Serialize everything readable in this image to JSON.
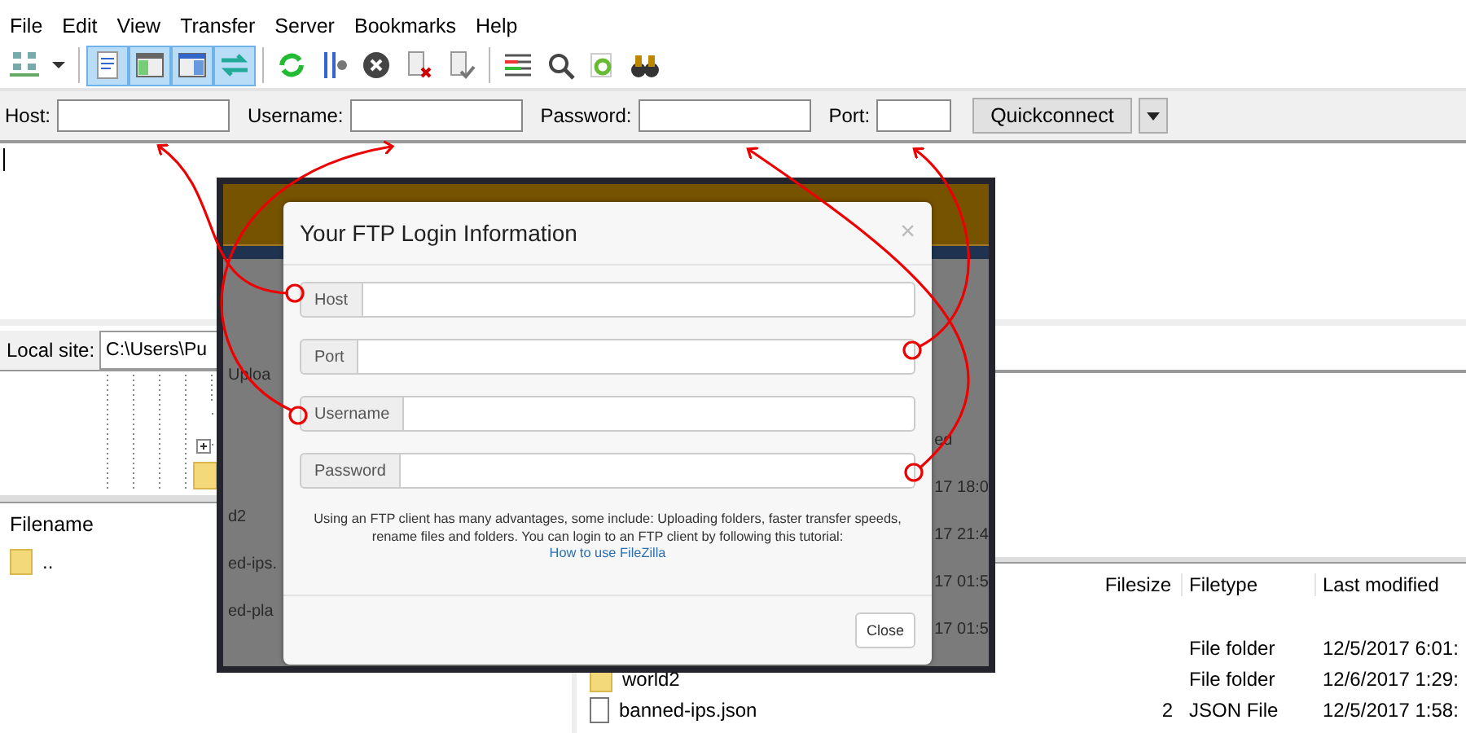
{
  "menu": [
    "File",
    "Edit",
    "View",
    "Transfer",
    "Server",
    "Bookmarks",
    "Help"
  ],
  "toolbar": [
    {
      "kind": "sitemanager",
      "pressed": false
    },
    {
      "kind": "dropdown",
      "pressed": false
    },
    {
      "kind": "sep"
    },
    {
      "kind": "log",
      "pressed": true
    },
    {
      "kind": "localtree",
      "pressed": true
    },
    {
      "kind": "remotetree",
      "pressed": true
    },
    {
      "kind": "queue",
      "pressed": true
    },
    {
      "kind": "sep"
    },
    {
      "kind": "refresh",
      "pressed": false
    },
    {
      "kind": "filter",
      "pressed": false
    },
    {
      "kind": "cancel",
      "pressed": false
    },
    {
      "kind": "disconnect",
      "pressed": false
    },
    {
      "kind": "reconnect",
      "pressed": false
    },
    {
      "kind": "sep"
    },
    {
      "kind": "listing",
      "pressed": false
    },
    {
      "kind": "compare",
      "pressed": false
    },
    {
      "kind": "sync",
      "pressed": false
    },
    {
      "kind": "find",
      "pressed": false
    }
  ],
  "quickconnect": {
    "fields": [
      {
        "label": "Host:"
      },
      {
        "label": "Username:"
      },
      {
        "label": "Password:"
      },
      {
        "label": "Port:"
      }
    ],
    "button": "Quickconnect"
  },
  "local_site": {
    "label": "Local site:",
    "path": "C:\\Users\\Pu"
  },
  "local_files": {
    "columns": [
      "Filename"
    ],
    "rows": [
      ".."
    ]
  },
  "remote_files": {
    "columns": [
      "Filesize",
      "Filetype",
      "Last modified"
    ],
    "rows": [
      {
        "name": "",
        "size": "",
        "type": "File folder",
        "modified": "12/5/2017 6:01:"
      },
      {
        "name": "world2",
        "size": "",
        "type": "File folder",
        "modified": "12/6/2017 1:29:"
      },
      {
        "name": "banned-ips.json",
        "size": "2",
        "type": "JSON File",
        "modified": "12/5/2017 1:58:"
      }
    ]
  },
  "screenshot": {
    "left_texts": [
      "Uploa",
      "d2",
      "ed-ips.",
      "ed-pla"
    ],
    "right_texts": [
      "ed",
      "17 18:0",
      "17 21:4",
      "17 01:5",
      "17 01:5"
    ],
    "modal": {
      "title": "Your FTP Login Information",
      "close": "×",
      "fields": [
        {
          "label": "Host",
          "annotated": true
        },
        {
          "label": "Port",
          "annotated": true
        },
        {
          "label": "Username",
          "annotated": true
        },
        {
          "label": "Password",
          "annotated": true
        }
      ],
      "text": "Using an FTP client has many advantages, some include: Uploading folders, faster transfer speeds, rename files and folders. You can login to an FTP client by following this tutorial:",
      "link": "How to use FileZilla",
      "button": "Close"
    }
  }
}
